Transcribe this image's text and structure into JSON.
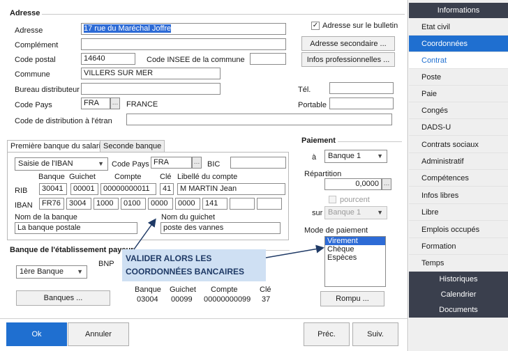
{
  "address": {
    "section_title": "Adresse",
    "adresse_label": "Adresse",
    "adresse_value": "17 rue du Maréchal Joffre",
    "complement_label": "Complément",
    "complement_value": "",
    "code_postal_label": "Code postal",
    "code_postal_value": "14640",
    "insee_label": "Code INSEE de la commune",
    "insee_value": "",
    "commune_label": "Commune",
    "commune_value": "VILLERS SUR MER",
    "bureau_label": "Bureau distributeur",
    "bureau_value": "",
    "code_pays_label": "Code Pays",
    "code_pays_value": "FRA",
    "pays_name": "FRANCE",
    "distribution_label": "Code de distribution à l'étran",
    "distribution_value": "",
    "bulletin_checkbox_label": "Adresse sur le bulletin",
    "bulletin_checked": "✓",
    "secondary_button": "Adresse secondaire ...",
    "pro_button": "Infos professionnelles ...",
    "tel_label": "Tél.",
    "tel_value": "",
    "portable_label": "Portable",
    "portable_value": ""
  },
  "bank": {
    "tabs": [
      "Première banque du salarié",
      "Seconde banque"
    ],
    "saisie_select": "Saisie de l'IBAN",
    "code_pays_label": "Code Pays",
    "code_pays_value": "FRA",
    "bic_label": "BIC",
    "bic_value": "",
    "headers": {
      "banque": "Banque",
      "guichet": "Guichet",
      "compte": "Compte",
      "cle": "Clé",
      "libelle": "Libellé du compte"
    },
    "rib_label": "RIB",
    "rib": {
      "banque": "30041",
      "guichet": "00001",
      "compte": "00000000011",
      "cle": "41",
      "libelle": "M MARTIN Jean"
    },
    "iban_label": "IBAN",
    "iban": [
      "FR76",
      "3004",
      "1000",
      "0100",
      "0000",
      "0000",
      "141",
      "",
      ""
    ],
    "nom_banque_label": "Nom de la banque",
    "nom_banque_value": "La banque postale",
    "nom_guichet_label": "Nom du guichet",
    "nom_guichet_value": "poste des vannes"
  },
  "employer_bank": {
    "title": "Banque de l'établissement payeur",
    "select_value": "1ère Banque",
    "bnp_label": "BNP",
    "banques_button": "Banques ...",
    "headers": {
      "banque": "Banque",
      "guichet": "Guichet",
      "compte": "Compte",
      "cle": "Clé"
    },
    "values": {
      "banque": "03004",
      "guichet": "00099",
      "compte": "00000000099",
      "cle": "37"
    }
  },
  "callout": {
    "line1": "VALIDER ALORS LES",
    "line2": "COORDONNÉES BANCAIRES"
  },
  "payment": {
    "title": "Paiement",
    "a_label": "à",
    "a_value": "Banque 1",
    "repartition_label": "Répartition",
    "repartition_value": "0,0000",
    "pourcent_label": "pourcent",
    "sur_label": "sur",
    "sur_value": "Banque 1",
    "mode_label": "Mode de paiement",
    "modes": [
      "Virement",
      "Chèque",
      "Espèces"
    ],
    "rompu_button": "Rompu ..."
  },
  "footer": {
    "ok": "Ok",
    "annuler": "Annuler",
    "prec": "Préc.",
    "suiv": "Suiv."
  },
  "sidebar": {
    "informations": "Informations",
    "items": [
      "Etat civil",
      "Coordonnées",
      "Contrat",
      "Poste",
      "Paie",
      "Congés",
      "DADS-U",
      "Contrats sociaux",
      "Administratif",
      "Compétences",
      "Infos libres",
      "Libre",
      "Emplois occupés",
      "Formation",
      "Temps"
    ],
    "bottom": [
      "Historiques",
      "Calendrier",
      "Documents"
    ]
  },
  "colors": {
    "primary": "#1f6fd0",
    "dark_header": "#3a3f4d",
    "callout_bg": "#cfe0f3"
  }
}
